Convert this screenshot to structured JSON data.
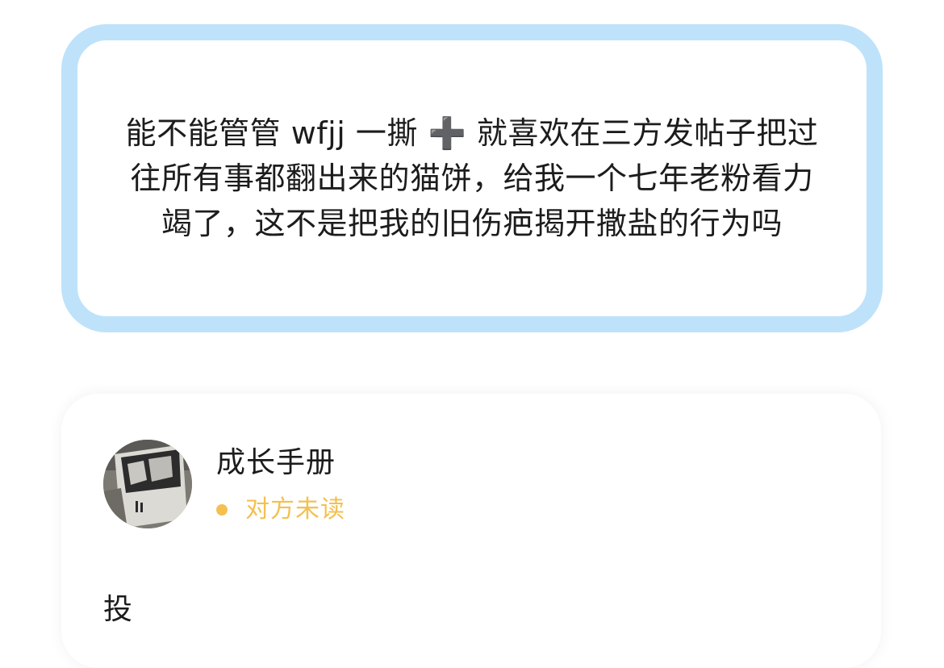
{
  "quote": {
    "text": "能不能管管 wfjj 一撕 ➕ 就喜欢在三方发帖子把过往所有事都翻出来的猫饼，给我一个七年老粉看力竭了，这不是把我的旧伤疤揭开撒盐的行为吗"
  },
  "message": {
    "sender": "成长手册",
    "avatar_icon": "book-cover-avatar-icon",
    "status_text": "对方未读",
    "status_color": "#f4c04f",
    "body": "投"
  },
  "colors": {
    "quote_border": "#bfe2fb",
    "text": "#1c1c1c"
  }
}
